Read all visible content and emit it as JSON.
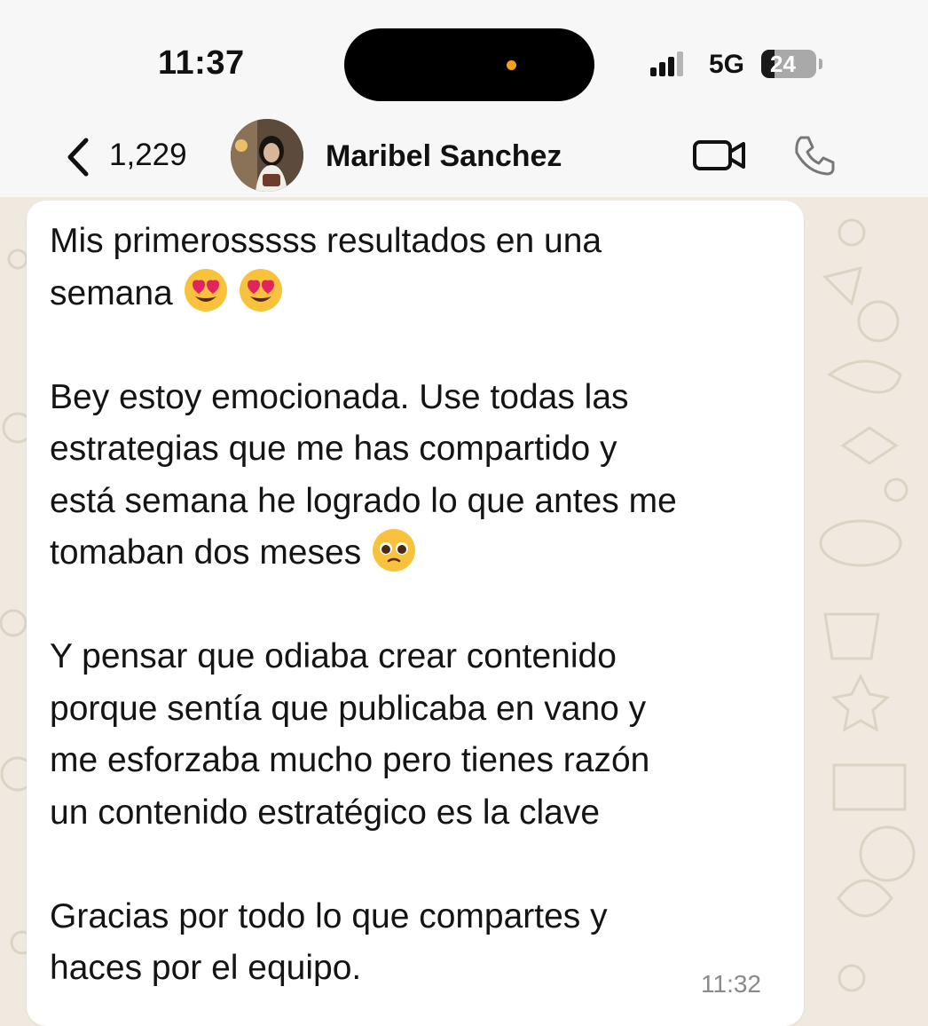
{
  "status_bar": {
    "time": "11:37",
    "network": "5G",
    "battery": "24",
    "battery_level": 0.24
  },
  "header": {
    "back_count": "1,229",
    "contact_name": "Maribel Sanchez",
    "icons": {
      "back": "chevron-left-icon",
      "video": "video-camera-icon",
      "phone": "phone-icon"
    }
  },
  "message": {
    "line_1": "Mis primerosssss resultados en una",
    "line_2": "semana",
    "line_3": "Bey estoy emocionada. Use todas las",
    "line_4": "estrategias que me has compartido y",
    "line_5": "está semana he logrado lo que antes me",
    "line_6": "tomaban dos meses",
    "line_7": "Y pensar que odiaba crear contenido",
    "line_8": "porque sentía que publicaba en vano y",
    "line_9": "me esforzaba mucho pero tienes razón",
    "line_10": "un contenido estratégico es la clave",
    "line_11": "Gracias por todo lo que compartes y",
    "line_12": "haces por el equipo.",
    "time": "11:32",
    "emojis": [
      "heart-eyes-emoji",
      "heart-eyes-emoji",
      "pleading-face-emoji"
    ]
  },
  "colors": {
    "header_bg": "#f7f7f7",
    "wallpaper": "#efe9df",
    "bubble": "#ffffff",
    "island_dot": "#f5a017"
  }
}
